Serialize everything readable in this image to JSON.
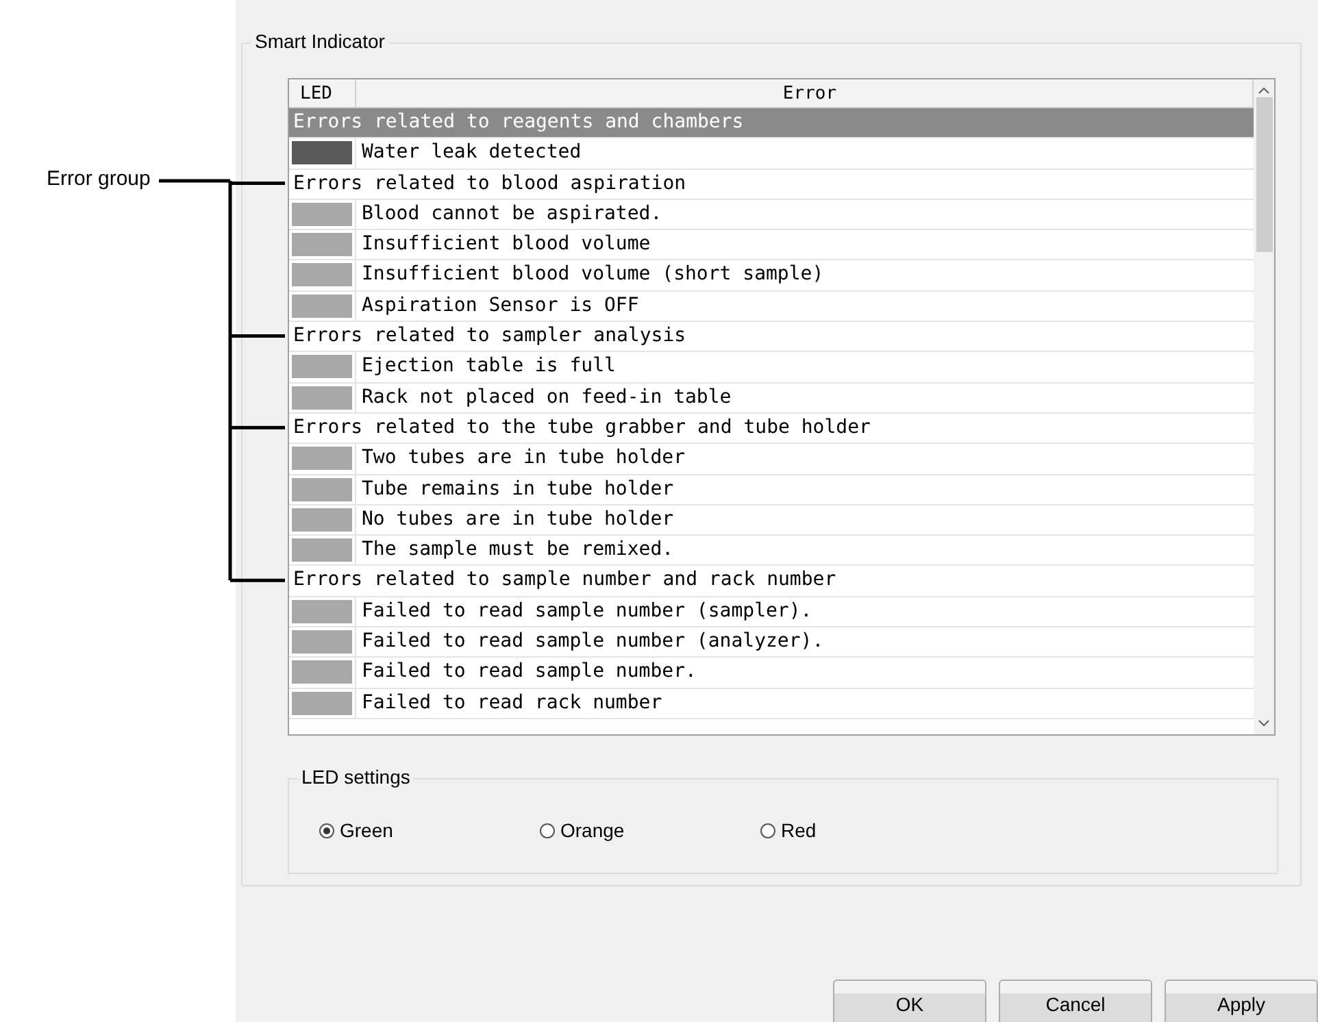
{
  "callout": {
    "label": "Error group"
  },
  "smart_indicator": {
    "title": "Smart Indicator",
    "table": {
      "columns": [
        "LED",
        "Error"
      ],
      "rows": [
        {
          "kind": "group",
          "text": "Errors related to reagents and chambers",
          "selected": true,
          "callout": false
        },
        {
          "kind": "error",
          "text": "Water leak detected",
          "led_on": true
        },
        {
          "kind": "group",
          "text": "Errors related to blood aspiration",
          "selected": false,
          "callout": true
        },
        {
          "kind": "error",
          "text": "Blood cannot be aspirated.",
          "led_on": false
        },
        {
          "kind": "error",
          "text": "Insufficient blood volume",
          "led_on": false
        },
        {
          "kind": "error",
          "text": "Insufficient blood volume (short sample)",
          "led_on": false
        },
        {
          "kind": "error",
          "text": "Aspiration Sensor is OFF",
          "led_on": false
        },
        {
          "kind": "group",
          "text": "Errors related to sampler analysis",
          "selected": false,
          "callout": true
        },
        {
          "kind": "error",
          "text": "Ejection table is full",
          "led_on": false
        },
        {
          "kind": "error",
          "text": "Rack not placed on feed-in table",
          "led_on": false
        },
        {
          "kind": "group",
          "text": "Errors related to the tube grabber and tube holder",
          "selected": false,
          "callout": true
        },
        {
          "kind": "error",
          "text": "Two tubes are in tube holder",
          "led_on": false
        },
        {
          "kind": "error",
          "text": "Tube remains in tube holder",
          "led_on": false
        },
        {
          "kind": "error",
          "text": "No tubes are in tube holder",
          "led_on": false
        },
        {
          "kind": "error",
          "text": "The sample must be remixed.",
          "led_on": false
        },
        {
          "kind": "group",
          "text": "Errors related to sample number and rack number",
          "selected": false,
          "callout": true
        },
        {
          "kind": "error",
          "text": "Failed to read sample number (sampler).",
          "led_on": false
        },
        {
          "kind": "error",
          "text": "Failed to read sample number (analyzer).",
          "led_on": false
        },
        {
          "kind": "error",
          "text": "Failed to read sample number.",
          "led_on": false
        },
        {
          "kind": "error",
          "text": "Failed to read rack number",
          "led_on": false
        }
      ]
    },
    "led_settings": {
      "title": "LED settings",
      "options": [
        {
          "label": "Green",
          "selected": true
        },
        {
          "label": "Orange",
          "selected": false
        },
        {
          "label": "Red",
          "selected": false
        }
      ]
    }
  },
  "buttons": [
    "OK",
    "Cancel",
    "Apply"
  ]
}
